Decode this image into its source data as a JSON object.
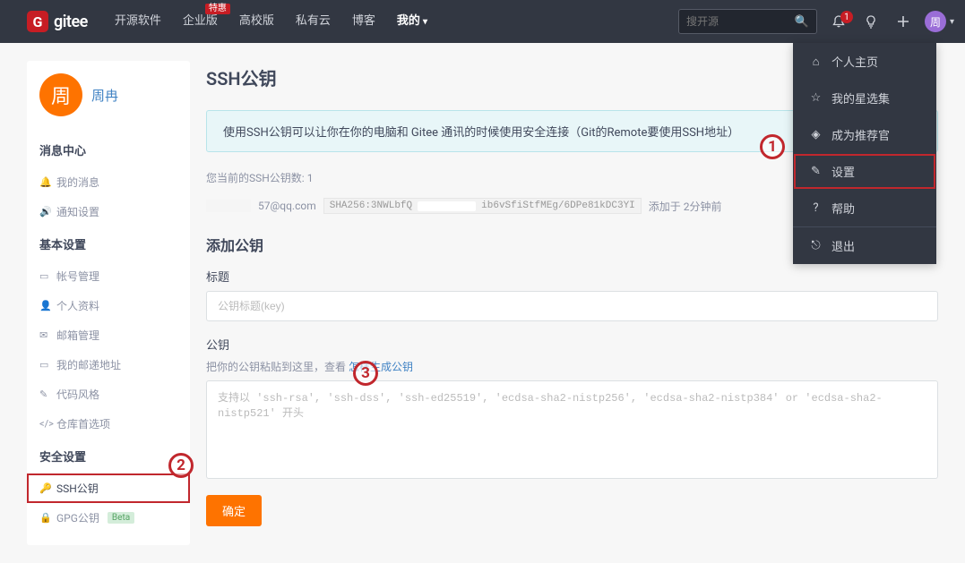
{
  "header": {
    "logo_text": "gitee",
    "nav": [
      {
        "label": "开源软件",
        "badge": ""
      },
      {
        "label": "企业版",
        "badge": "特惠"
      },
      {
        "label": "高校版",
        "badge": ""
      },
      {
        "label": "私有云",
        "badge": ""
      },
      {
        "label": "博客",
        "badge": ""
      },
      {
        "label": "我的",
        "badge": "",
        "active": true,
        "dropdown": true
      }
    ],
    "search_placeholder": "搜开源",
    "notif_count": "1",
    "avatar_char": "周"
  },
  "dropdown": {
    "items": [
      {
        "icon": "home",
        "label": "个人主页"
      },
      {
        "icon": "star",
        "label": "我的星选集"
      },
      {
        "icon": "badge",
        "label": "成为推荐官"
      },
      {
        "icon": "edit",
        "label": "设置",
        "highlighted": true
      },
      {
        "icon": "help",
        "label": "帮助"
      },
      {
        "icon": "exit",
        "label": "退出"
      }
    ]
  },
  "sidebar": {
    "avatar_char": "周",
    "name": "周冉",
    "sections": [
      {
        "title": "消息中心",
        "items": [
          {
            "icon": "bell",
            "label": "我的消息"
          },
          {
            "icon": "sound",
            "label": "通知设置"
          }
        ]
      },
      {
        "title": "基本设置",
        "items": [
          {
            "icon": "id",
            "label": "帐号管理"
          },
          {
            "icon": "user",
            "label": "个人资料"
          },
          {
            "icon": "mail",
            "label": "邮箱管理"
          },
          {
            "icon": "card",
            "label": "我的邮递地址"
          },
          {
            "icon": "pencil",
            "label": "代码风格"
          },
          {
            "icon": "code",
            "label": "仓库首选项"
          }
        ]
      },
      {
        "title": "安全设置",
        "items": [
          {
            "icon": "key",
            "label": "SSH公钥",
            "highlighted": true
          },
          {
            "icon": "lock",
            "label": "GPG公钥",
            "beta": "Beta"
          }
        ]
      }
    ]
  },
  "main": {
    "title": "SSH公钥",
    "banner": "使用SSH公钥可以让你在你的电脑和 Gitee 通讯的时候使用安全连接（Git的Remote要使用SSH地址）",
    "count_label": "您当前的SSH公钥数: 1",
    "key": {
      "email_suffix": "57@qq.com",
      "hash_prefix": "SHA256:3NWLbfQ",
      "hash_suffix": "ib6vSfiStfMEg/6DPe81kDC3YI",
      "added": "添加于 2分钟前"
    },
    "form": {
      "section_title": "添加公钥",
      "title_label": "标题",
      "title_placeholder": "公钥标题(key)",
      "key_label": "公钥",
      "hint_prefix": "把你的公钥粘贴到这里，查看 ",
      "hint_link": "怎样生成公钥",
      "key_placeholder": "支持以 'ssh-rsa', 'ssh-dss', 'ssh-ed25519', 'ecdsa-sha2-nistp256', 'ecdsa-sha2-nistp384' or 'ecdsa-sha2-nistp521' 开头",
      "submit": "确定"
    }
  },
  "annotations": {
    "a1": "1",
    "a2": "2",
    "a3": "3"
  }
}
